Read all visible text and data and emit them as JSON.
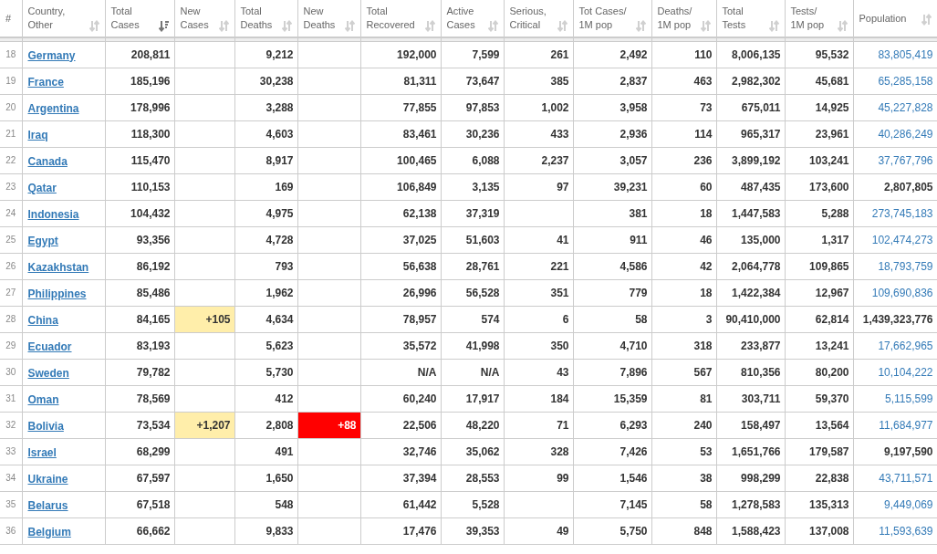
{
  "table": {
    "columns": [
      {
        "label": "#",
        "kind": "rank"
      },
      {
        "label": "Country,\nOther",
        "kind": "country",
        "sorted": false
      },
      {
        "label": "Total\nCases",
        "kind": "number",
        "sorted": true
      },
      {
        "label": "New\nCases",
        "kind": "new_cases",
        "sorted": false
      },
      {
        "label": "Total\nDeaths",
        "kind": "number",
        "sorted": false
      },
      {
        "label": "New\nDeaths",
        "kind": "new_deaths",
        "sorted": false
      },
      {
        "label": "Total\nRecovered",
        "kind": "number",
        "sorted": false
      },
      {
        "label": "Active\nCases",
        "kind": "number",
        "sorted": false
      },
      {
        "label": "Serious,\nCritical",
        "kind": "number",
        "sorted": false
      },
      {
        "label": "Tot Cases/\n1M pop",
        "kind": "number",
        "sorted": false
      },
      {
        "label": "Deaths/\n1M pop",
        "kind": "number",
        "sorted": false
      },
      {
        "label": "Total\nTests",
        "kind": "number",
        "sorted": false
      },
      {
        "label": "Tests/\n1M pop",
        "kind": "number",
        "sorted": false
      },
      {
        "label": "Population",
        "kind": "population",
        "sorted": false
      }
    ],
    "rows": [
      {
        "cells": [
          "18",
          "Germany",
          "208,811",
          null,
          "9,212",
          null,
          "192,000",
          "7,599",
          "261",
          "2,492",
          "110",
          "8,006,135",
          "95,532",
          "83,805,419"
        ],
        "population_linked": true
      },
      {
        "cells": [
          "19",
          "France",
          "185,196",
          null,
          "30,238",
          null,
          "81,311",
          "73,647",
          "385",
          "2,837",
          "463",
          "2,982,302",
          "45,681",
          "65,285,158"
        ],
        "population_linked": true
      },
      {
        "cells": [
          "20",
          "Argentina",
          "178,996",
          null,
          "3,288",
          null,
          "77,855",
          "97,853",
          "1,002",
          "3,958",
          "73",
          "675,011",
          "14,925",
          "45,227,828"
        ],
        "population_linked": true
      },
      {
        "cells": [
          "21",
          "Iraq",
          "118,300",
          null,
          "4,603",
          null,
          "83,461",
          "30,236",
          "433",
          "2,936",
          "114",
          "965,317",
          "23,961",
          "40,286,249"
        ],
        "population_linked": true
      },
      {
        "cells": [
          "22",
          "Canada",
          "115,470",
          null,
          "8,917",
          null,
          "100,465",
          "6,088",
          "2,237",
          "3,057",
          "236",
          "3,899,192",
          "103,241",
          "37,767,796"
        ],
        "population_linked": true
      },
      {
        "cells": [
          "23",
          "Qatar",
          "110,153",
          null,
          "169",
          null,
          "106,849",
          "3,135",
          "97",
          "39,231",
          "60",
          "487,435",
          "173,600",
          "2,807,805"
        ],
        "population_linked": false
      },
      {
        "cells": [
          "24",
          "Indonesia",
          "104,432",
          null,
          "4,975",
          null,
          "62,138",
          "37,319",
          null,
          "381",
          "18",
          "1,447,583",
          "5,288",
          "273,745,183"
        ],
        "population_linked": true
      },
      {
        "cells": [
          "25",
          "Egypt",
          "93,356",
          null,
          "4,728",
          null,
          "37,025",
          "51,603",
          "41",
          "911",
          "46",
          "135,000",
          "1,317",
          "102,474,273"
        ],
        "population_linked": true
      },
      {
        "cells": [
          "26",
          "Kazakhstan",
          "86,192",
          null,
          "793",
          null,
          "56,638",
          "28,761",
          "221",
          "4,586",
          "42",
          "2,064,778",
          "109,865",
          "18,793,759"
        ],
        "population_linked": true
      },
      {
        "cells": [
          "27",
          "Philippines",
          "85,486",
          null,
          "1,962",
          null,
          "26,996",
          "56,528",
          "351",
          "779",
          "18",
          "1,422,384",
          "12,967",
          "109,690,836"
        ],
        "population_linked": true
      },
      {
        "cells": [
          "28",
          "China",
          "84,165",
          "+105",
          "4,634",
          null,
          "78,957",
          "574",
          "6",
          "58",
          "3",
          "90,410,000",
          "62,814",
          "1,439,323,776"
        ],
        "population_linked": false
      },
      {
        "cells": [
          "29",
          "Ecuador",
          "83,193",
          null,
          "5,623",
          null,
          "35,572",
          "41,998",
          "350",
          "4,710",
          "318",
          "233,877",
          "13,241",
          "17,662,965"
        ],
        "population_linked": true
      },
      {
        "cells": [
          "30",
          "Sweden",
          "79,782",
          null,
          "5,730",
          null,
          "N/A",
          "N/A",
          "43",
          "7,896",
          "567",
          "810,356",
          "80,200",
          "10,104,222"
        ],
        "population_linked": true
      },
      {
        "cells": [
          "31",
          "Oman",
          "78,569",
          null,
          "412",
          null,
          "60,240",
          "17,917",
          "184",
          "15,359",
          "81",
          "303,711",
          "59,370",
          "5,115,599"
        ],
        "population_linked": true
      },
      {
        "cells": [
          "32",
          "Bolivia",
          "73,534",
          "+1,207",
          "2,808",
          "+88",
          "22,506",
          "48,220",
          "71",
          "6,293",
          "240",
          "158,497",
          "13,564",
          "11,684,977"
        ],
        "population_linked": true
      },
      {
        "cells": [
          "33",
          "Israel",
          "68,299",
          null,
          "491",
          null,
          "32,746",
          "35,062",
          "328",
          "7,426",
          "53",
          "1,651,766",
          "179,587",
          "9,197,590"
        ],
        "population_linked": false
      },
      {
        "cells": [
          "34",
          "Ukraine",
          "67,597",
          null,
          "1,650",
          null,
          "37,394",
          "28,553",
          "99",
          "1,546",
          "38",
          "998,299",
          "22,838",
          "43,711,571"
        ],
        "population_linked": true
      },
      {
        "cells": [
          "35",
          "Belarus",
          "67,518",
          null,
          "548",
          null,
          "61,442",
          "5,528",
          null,
          "7,145",
          "58",
          "1,278,583",
          "135,313",
          "9,449,069"
        ],
        "population_linked": true
      },
      {
        "cells": [
          "36",
          "Belgium",
          "66,662",
          null,
          "9,833",
          null,
          "17,476",
          "39,353",
          "49",
          "5,750",
          "848",
          "1,588,423",
          "137,008",
          "11,593,639"
        ],
        "population_linked": true
      }
    ]
  }
}
